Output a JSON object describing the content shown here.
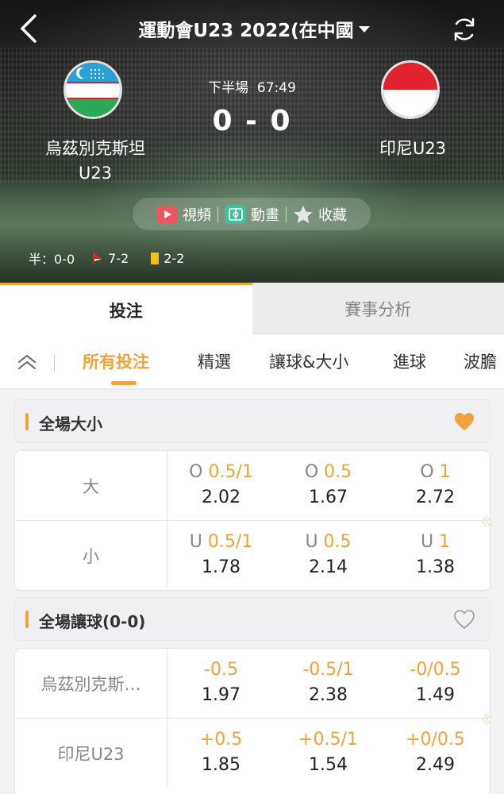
{
  "header": {
    "title": "運動會U23 2022(在中國"
  },
  "match": {
    "status": "下半場",
    "time": "67:49",
    "score": "0 - 0",
    "home_team": "烏茲別克斯坦",
    "home_team_line2": "U23",
    "away_team": "印尼U23",
    "home_flag_colors": [
      "#2a9fd8",
      "#ffffff",
      "#2aa85a"
    ],
    "away_flag_colors": [
      "#e0232f",
      "#ffffff"
    ]
  },
  "actions": {
    "video": "視頻",
    "animation": "動畫",
    "favorite": "收藏"
  },
  "stats": {
    "half_label": "半：0-0",
    "corners": "7-2",
    "yellow_cards": "2-2"
  },
  "main_tabs": {
    "bet": "投注",
    "analysis": "賽事分析"
  },
  "filters": {
    "all": "所有投注",
    "featured": "精選",
    "handicap_ou": "讓球&大小",
    "goals": "進球",
    "more": "波膽"
  },
  "colors": {
    "accent": "#f0a33a",
    "text_dark": "#222222",
    "text_muted": "#888888"
  },
  "sections": {
    "total": {
      "title": "全場大小",
      "favorite": true,
      "rows": [
        {
          "label": "大",
          "cells": [
            {
              "prefix": "O",
              "handicap": "0.5/1",
              "odds": "2.02"
            },
            {
              "prefix": "O",
              "handicap": "0.5",
              "odds": "1.67"
            },
            {
              "prefix": "O",
              "handicap": "1",
              "odds": "2.72"
            }
          ]
        },
        {
          "label": "小",
          "cells": [
            {
              "prefix": "U",
              "handicap": "0.5/1",
              "odds": "1.78"
            },
            {
              "prefix": "U",
              "handicap": "0.5",
              "odds": "2.14"
            },
            {
              "prefix": "U",
              "handicap": "1",
              "odds": "1.38"
            }
          ]
        }
      ]
    },
    "handicap": {
      "title": "全場讓球(0-0)",
      "favorite": false,
      "rows": [
        {
          "label": "烏茲別克斯…",
          "cells": [
            {
              "prefix": "",
              "handicap": "-0.5",
              "odds": "1.97"
            },
            {
              "prefix": "",
              "handicap": "-0.5/1",
              "odds": "2.38"
            },
            {
              "prefix": "",
              "handicap": "-0/0.5",
              "odds": "1.49"
            }
          ]
        },
        {
          "label": "印尼U23",
          "cells": [
            {
              "prefix": "",
              "handicap": "+0.5",
              "odds": "1.85"
            },
            {
              "prefix": "",
              "handicap": "+0.5/1",
              "odds": "1.54"
            },
            {
              "prefix": "",
              "handicap": "+0/0.5",
              "odds": "2.49"
            }
          ]
        }
      ]
    }
  }
}
